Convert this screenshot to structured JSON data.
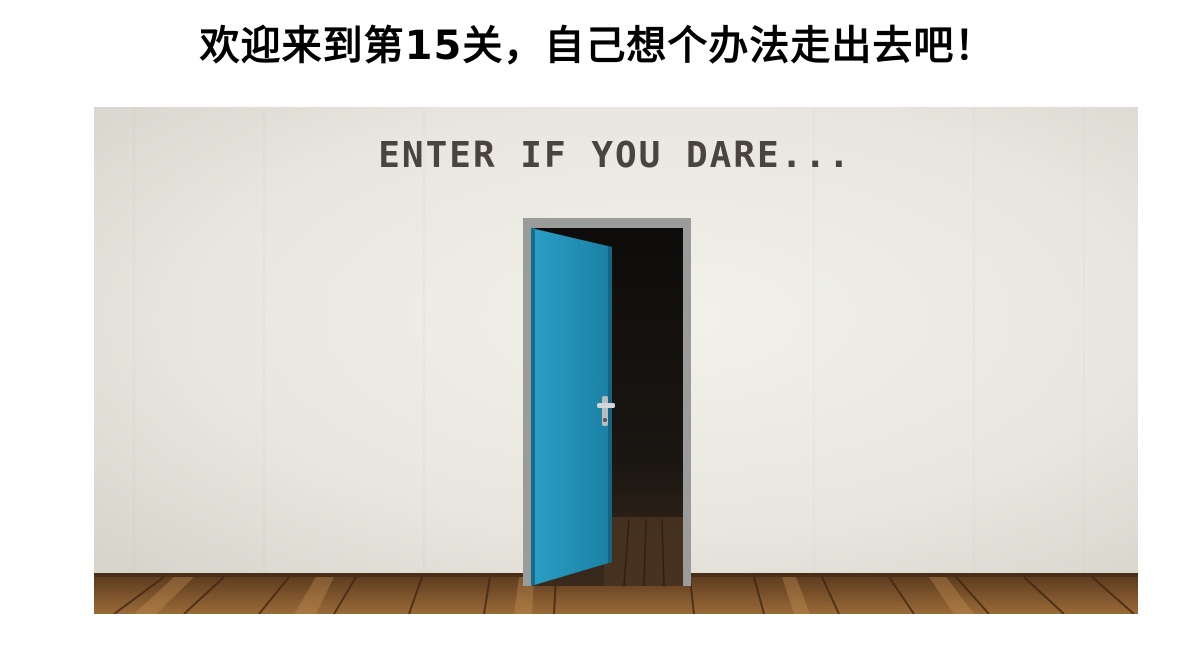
{
  "level": {
    "title": "欢迎来到第15关，自己想个办法走出去吧！"
  },
  "scene": {
    "wall_sign": "ENTER IF YOU DARE...",
    "colors": {
      "wall": "#ecebe4",
      "door": "#1f8db2",
      "door_frame": "#9a9c9c",
      "doorway_dark": "#141210",
      "floor": "#8a5a2e"
    },
    "icons": [
      "door-icon",
      "door-handle-icon"
    ]
  }
}
